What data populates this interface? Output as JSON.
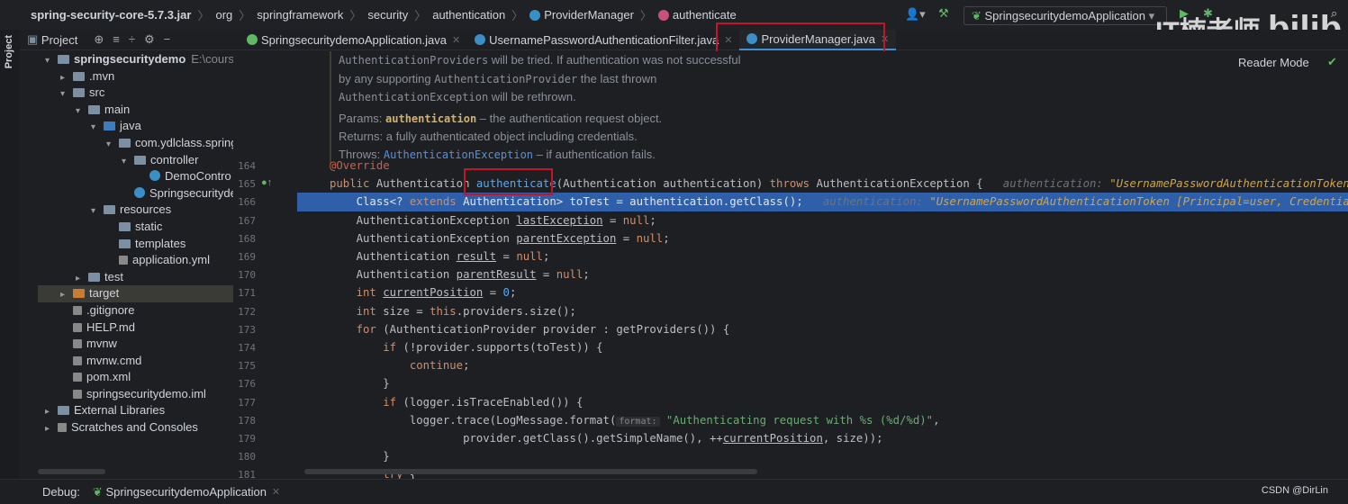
{
  "breadcrumb": [
    "spring-security-core-5.7.3.jar",
    "org",
    "springframework",
    "security",
    "authentication",
    "ProviderManager",
    "authenticate"
  ],
  "toolbar": {
    "run_config": "SpringsecuritydemoApplication"
  },
  "watermark": "IT楠老师 bilibili",
  "project_panel": {
    "label": "Project",
    "strip_label": "Project"
  },
  "tabs": [
    {
      "label": "SpringsecuritydemoApplication.java",
      "active": false
    },
    {
      "label": "UsernamePasswordAuthenticationFilter.java",
      "active": false
    },
    {
      "label": "ProviderManager.java",
      "active": true
    }
  ],
  "tree": [
    {
      "label": "springsecuritydemo",
      "extra": "E:\\course",
      "level": 0,
      "arrow": "▾",
      "icon": "folder",
      "bold": true
    },
    {
      "label": ".mvn",
      "level": 1,
      "arrow": "▸",
      "icon": "folder"
    },
    {
      "label": "src",
      "level": 1,
      "arrow": "▾",
      "icon": "folder"
    },
    {
      "label": "main",
      "level": 2,
      "arrow": "▾",
      "icon": "folder"
    },
    {
      "label": "java",
      "level": 3,
      "arrow": "▾",
      "icon": "src"
    },
    {
      "label": "com.ydlclass.spring",
      "level": 4,
      "arrow": "▾",
      "icon": "folder"
    },
    {
      "label": "controller",
      "level": 5,
      "arrow": "▾",
      "icon": "folder"
    },
    {
      "label": "DemoContro",
      "level": 6,
      "arrow": "",
      "icon": "cls"
    },
    {
      "label": "Springsecuritydem",
      "level": 5,
      "arrow": "",
      "icon": "cls"
    },
    {
      "label": "resources",
      "level": 3,
      "arrow": "▾",
      "icon": "folder"
    },
    {
      "label": "static",
      "level": 4,
      "arrow": "",
      "icon": "folder"
    },
    {
      "label": "templates",
      "level": 4,
      "arrow": "",
      "icon": "folder"
    },
    {
      "label": "application.yml",
      "level": 4,
      "arrow": "",
      "icon": "file"
    },
    {
      "label": "test",
      "level": 2,
      "arrow": "▸",
      "icon": "folder"
    },
    {
      "label": "target",
      "level": 1,
      "arrow": "▸",
      "icon": "tgt",
      "selected": true
    },
    {
      "label": ".gitignore",
      "level": 1,
      "arrow": "",
      "icon": "file"
    },
    {
      "label": "HELP.md",
      "level": 1,
      "arrow": "",
      "icon": "file"
    },
    {
      "label": "mvnw",
      "level": 1,
      "arrow": "",
      "icon": "file"
    },
    {
      "label": "mvnw.cmd",
      "level": 1,
      "arrow": "",
      "icon": "file"
    },
    {
      "label": "pom.xml",
      "level": 1,
      "arrow": "",
      "icon": "file"
    },
    {
      "label": "springsecuritydemo.iml",
      "level": 1,
      "arrow": "",
      "icon": "file"
    },
    {
      "label": "External Libraries",
      "level": 0,
      "arrow": "▸",
      "icon": "folder"
    },
    {
      "label": "Scratches and Consoles",
      "level": 0,
      "arrow": "▸",
      "icon": "file"
    }
  ],
  "doc": {
    "lines": [
      [
        [
          "AuthenticationProviders",
          "m"
        ],
        [
          " will be tried. If authentication was not successful",
          ""
        ]
      ],
      [
        [
          "by any supporting ",
          ""
        ],
        [
          "AuthenticationProvider",
          "m"
        ],
        [
          " the last thrown",
          ""
        ]
      ],
      [
        [
          "AuthenticationException",
          "m"
        ],
        [
          " will be rethrown.",
          ""
        ]
      ]
    ],
    "params_label": "Params:",
    "params_name": "authentication",
    "params_text": " – the authentication request object.",
    "returns": "Returns: a fully authenticated object including credentials.",
    "throws_label": "Throws:",
    "throws_link": "AuthenticationException",
    "throws_text": " – if authentication fails."
  },
  "reader_mode": "Reader Mode",
  "code": [
    {
      "n": "164",
      "t": [
        [
          "@Override",
          "an"
        ]
      ]
    },
    {
      "n": "165",
      "t": [
        [
          "public ",
          "kw"
        ],
        [
          "Authentication ",
          ""
        ],
        [
          "authenticate",
          "fn"
        ],
        [
          "(Authentication authentication) ",
          ""
        ],
        [
          "throws ",
          "kw"
        ],
        [
          "AuthenticationException {",
          ""
        ],
        [
          "   authentication: ",
          "hint"
        ],
        [
          "\"UsernamePasswordAuthenticationToken [Principal=user, Credentials=[PROTECTED]",
          "hv"
        ]
      ]
    },
    {
      "n": "166",
      "cur": true,
      "t": [
        [
          "    Class<? ",
          ""
        ],
        [
          "extends ",
          "kw"
        ],
        [
          "Authentication> toTest = authentication.getClass();",
          ""
        ],
        [
          "   authentication: ",
          "hint"
        ],
        [
          "\"UsernamePasswordAuthenticationToken [Principal=user, Credentials=[PROTECTED]",
          "hv"
        ]
      ]
    },
    {
      "n": "167",
      "t": [
        [
          "    AuthenticationException ",
          ""
        ],
        [
          "lastException",
          "u"
        ],
        [
          " = ",
          ""
        ],
        [
          "null",
          "kw"
        ],
        [
          ";",
          ""
        ]
      ]
    },
    {
      "n": "168",
      "t": [
        [
          "    AuthenticationException ",
          ""
        ],
        [
          "parentException",
          "u"
        ],
        [
          " = ",
          ""
        ],
        [
          "null",
          "kw"
        ],
        [
          ";",
          ""
        ]
      ]
    },
    {
      "n": "169",
      "t": [
        [
          "    Authentication ",
          ""
        ],
        [
          "result",
          "u"
        ],
        [
          " = ",
          ""
        ],
        [
          "null",
          "kw"
        ],
        [
          ";",
          ""
        ]
      ]
    },
    {
      "n": "170",
      "t": [
        [
          "    Authentication ",
          ""
        ],
        [
          "parentResult",
          "u"
        ],
        [
          " = ",
          ""
        ],
        [
          "null",
          "kw"
        ],
        [
          ";",
          ""
        ]
      ]
    },
    {
      "n": "171",
      "t": [
        [
          "    ",
          ""
        ],
        [
          "int ",
          "kw"
        ],
        [
          "currentPosition",
          "u"
        ],
        [
          " = ",
          ""
        ],
        [
          "0",
          "fn"
        ],
        [
          ";",
          ""
        ]
      ]
    },
    {
      "n": "172",
      "t": [
        [
          "    ",
          ""
        ],
        [
          "int ",
          "kw"
        ],
        [
          "size = ",
          ""
        ],
        [
          "this",
          "kw"
        ],
        [
          ".providers.size();",
          ""
        ]
      ]
    },
    {
      "n": "173",
      "t": [
        [
          "    ",
          ""
        ],
        [
          "for ",
          "kw"
        ],
        [
          "(AuthenticationProvider provider : getProviders()) {",
          ""
        ]
      ]
    },
    {
      "n": "174",
      "t": [
        [
          "        ",
          ""
        ],
        [
          "if ",
          "kw"
        ],
        [
          "(!provider.supports(toTest)) {",
          ""
        ]
      ]
    },
    {
      "n": "175",
      "t": [
        [
          "            ",
          ""
        ],
        [
          "continue",
          "kw"
        ],
        [
          ";",
          ""
        ]
      ]
    },
    {
      "n": "176",
      "t": [
        [
          "        }",
          ""
        ]
      ]
    },
    {
      "n": "177",
      "t": [
        [
          "        ",
          ""
        ],
        [
          "if ",
          "kw"
        ],
        [
          "(logger.isTraceEnabled()) {",
          ""
        ]
      ]
    },
    {
      "n": "178",
      "t": [
        [
          "            logger.trace(LogMessage.format(",
          ""
        ],
        [
          "format:",
          "tag"
        ],
        [
          " ",
          ""
        ],
        [
          "\"Authenticating request with %s (%d/%d)\"",
          "str"
        ],
        [
          ",",
          ""
        ]
      ]
    },
    {
      "n": "179",
      "t": [
        [
          "                    provider.getClass().getSimpleName(), ++",
          ""
        ],
        [
          "currentPosition",
          "u"
        ],
        [
          ", size));",
          ""
        ]
      ]
    },
    {
      "n": "180",
      "t": [
        [
          "        }",
          ""
        ]
      ]
    },
    {
      "n": "181",
      "t": [
        [
          "        ",
          ""
        ],
        [
          "try ",
          "kw"
        ],
        [
          "{",
          ""
        ]
      ]
    }
  ],
  "debug": {
    "label": "Debug:",
    "session": "SpringsecuritydemoApplication"
  },
  "status": {
    "csdn": "CSDN @DirLin"
  },
  "colors": {
    "accent": "#3d8fd6",
    "highlight_box": "#c0152a",
    "current_line": "#2f5fa8"
  }
}
